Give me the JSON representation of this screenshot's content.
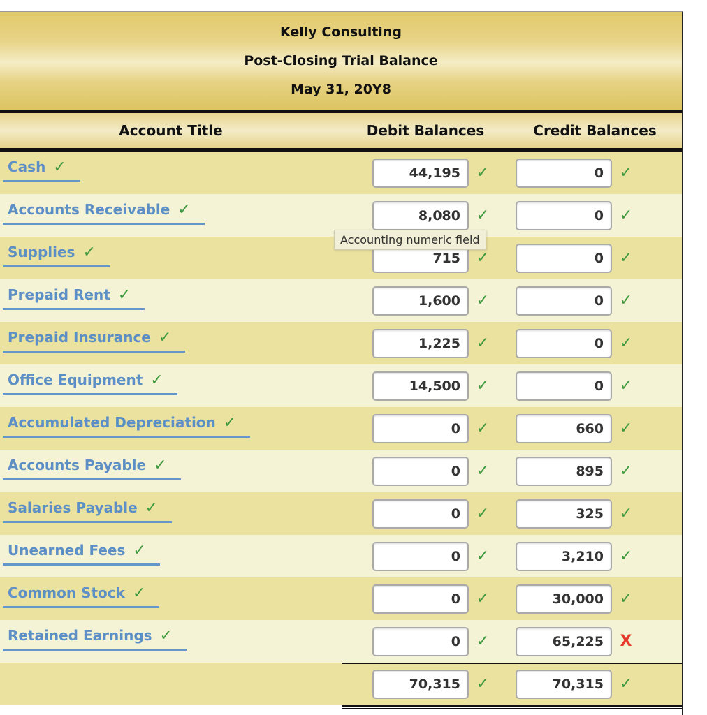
{
  "header": {
    "company": "Kelly Consulting",
    "statement": "Post-Closing Trial Balance",
    "date": "May 31, 20Y8"
  },
  "columns": {
    "account": "Account Title",
    "debit": "Debit Balances",
    "credit": "Credit Balances"
  },
  "rows": [
    {
      "account": "Cash",
      "account_status": "correct",
      "debit": "44,195",
      "debit_status": "correct",
      "credit": "0",
      "credit_status": "correct"
    },
    {
      "account": "Accounts Receivable",
      "account_status": "correct",
      "debit": "8,080",
      "debit_status": "correct",
      "credit": "0",
      "credit_status": "correct"
    },
    {
      "account": "Supplies",
      "account_status": "correct",
      "debit": "715",
      "debit_status": "correct",
      "credit": "0",
      "credit_status": "correct"
    },
    {
      "account": "Prepaid Rent",
      "account_status": "correct",
      "debit": "1,600",
      "debit_status": "correct",
      "credit": "0",
      "credit_status": "correct"
    },
    {
      "account": "Prepaid Insurance",
      "account_status": "correct",
      "debit": "1,225",
      "debit_status": "correct",
      "credit": "0",
      "credit_status": "correct"
    },
    {
      "account": "Office Equipment",
      "account_status": "correct",
      "debit": "14,500",
      "debit_status": "correct",
      "credit": "0",
      "credit_status": "correct"
    },
    {
      "account": "Accumulated Depreciation",
      "account_status": "correct",
      "debit": "0",
      "debit_status": "correct",
      "credit": "660",
      "credit_status": "correct"
    },
    {
      "account": "Accounts Payable",
      "account_status": "correct",
      "debit": "0",
      "debit_status": "correct",
      "credit": "895",
      "credit_status": "correct"
    },
    {
      "account": "Salaries Payable",
      "account_status": "correct",
      "debit": "0",
      "debit_status": "correct",
      "credit": "325",
      "credit_status": "correct"
    },
    {
      "account": "Unearned Fees",
      "account_status": "correct",
      "debit": "0",
      "debit_status": "correct",
      "credit": "3,210",
      "credit_status": "correct"
    },
    {
      "account": "Common Stock",
      "account_status": "correct",
      "debit": "0",
      "debit_status": "correct",
      "credit": "30,000",
      "credit_status": "correct"
    },
    {
      "account": "Retained Earnings",
      "account_status": "correct",
      "debit": "0",
      "debit_status": "correct",
      "credit": "65,225",
      "credit_status": "incorrect"
    }
  ],
  "totals": {
    "debit": "70,315",
    "debit_status": "correct",
    "credit": "70,315",
    "credit_status": "correct"
  },
  "tooltip": "Accounting numeric field",
  "icons": {
    "correct": "✓",
    "incorrect": "X"
  },
  "colors": {
    "check_green": "#3f9a3f",
    "error_red": "#e53b2c",
    "link_blue": "#5b8fc5"
  }
}
